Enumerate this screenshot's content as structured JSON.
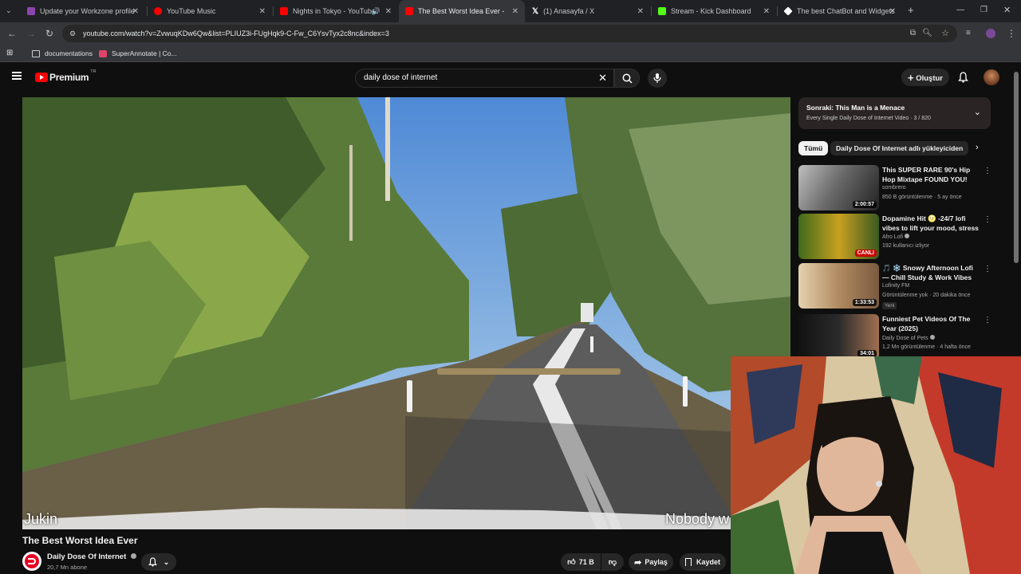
{
  "browser": {
    "tabs": [
      {
        "label": "Update your Workzone profile",
        "color": "#8e44ad"
      },
      {
        "label": "YouTube Music",
        "color": "#ff0000"
      },
      {
        "label": "Nights in Tokyo - YouTube",
        "color": "#ff0000"
      },
      {
        "label": "The Best Worst Idea Ever - YouTube",
        "color": "#ff0000"
      },
      {
        "label": "(1) Anasayfa / X",
        "color": "#ffffff"
      },
      {
        "label": "Stream - Kick Dashboard",
        "color": "#53fc18"
      },
      {
        "label": "The best ChatBot and Widgets",
        "color": "#ffffff"
      }
    ],
    "url": "youtube.com/watch?v=ZvwuqKDw6Qw&list=PLIUZ3i-FUgHqk9-C-Fw_C6YsvTyx2c8nc&index=3",
    "bookmarks": [
      {
        "label": "documentations"
      },
      {
        "label": "SuperAnnotate | Co..."
      }
    ]
  },
  "youtube": {
    "logo_text": "Premium",
    "logo_badge": "TR",
    "search_value": "daily dose of internet",
    "create_label": "Oluştur"
  },
  "video": {
    "caption_left": "Jukin",
    "caption_right": "Nobody w",
    "title": "The Best Worst Idea Ever",
    "channel": "Daily Dose Of Internet",
    "subscribers": "20,7 Mn abone",
    "likes": "71 B",
    "share_label": "Paylaş",
    "save_label": "Kaydet"
  },
  "playlist": {
    "next_title": "Sonraki: This Man is a Menace",
    "subtitle": "Every Single Daily Dose of Internet Video · 3 / 820"
  },
  "chips": [
    {
      "label": "Tümü"
    },
    {
      "label": "Daily Dose Of Internet adlı yükleyiciden"
    }
  ],
  "recommendations": [
    {
      "title": "This SUPER RARE 90's Hip Hop Mixtape FOUND YOU!",
      "channel": "sombrero",
      "meta": "850 B görüntülenme · 5 ay önce",
      "duration": "2:00:57",
      "thumb_color": "#6b6b6b",
      "badge": ""
    },
    {
      "title": "Dopamine Hit 🌝 -24/7 lofi vibes to lift your mood, stress ...",
      "channel": "Afro Lofi",
      "meta": "192 kullanıcı izliyor",
      "duration": "CANLI",
      "thumb_color": "#4a6b2a",
      "badge": ""
    },
    {
      "title": "🎵 ❄️ Snowy Afternoon Lofi — Chill Study & Work Vibes by th...",
      "channel": "Lofinity FM",
      "meta": "Görüntülenme yok · 20 dakika önce",
      "duration": "1:33:53",
      "thumb_color": "#c9a678",
      "badge": "Yeni"
    },
    {
      "title": "Funniest Pet Videos Of The Year (2025)",
      "channel": "Daily Dose of Pets",
      "meta": "1,2 Mn görüntülenme · 4 hafta önce",
      "duration": "34:01",
      "thumb_color": "#3a3a3a",
      "badge": ""
    }
  ]
}
